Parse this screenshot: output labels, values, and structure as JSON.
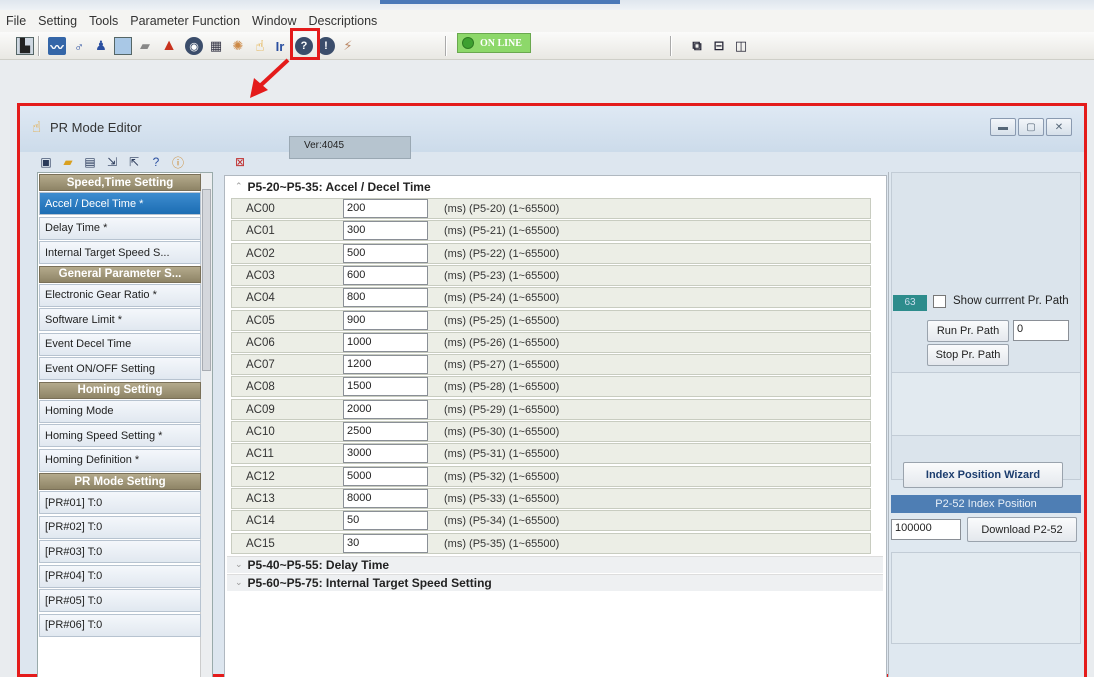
{
  "menu": [
    "File",
    "Setting",
    "Tools",
    "Parameter Function",
    "Window",
    "Descriptions"
  ],
  "toolbar": {
    "online_label": "ON LINE"
  },
  "editor": {
    "title": "PR Mode Editor",
    "version": "Ver:4045",
    "window_buttons": [
      "minimize",
      "maximize",
      "close"
    ]
  },
  "nav": {
    "items": [
      {
        "type": "head",
        "label": "Speed,Time Setting"
      },
      {
        "type": "item",
        "label": "Accel / Decel Time  *",
        "selected": true
      },
      {
        "type": "item",
        "label": "Delay Time  *"
      },
      {
        "type": "item",
        "label": "Internal Target Speed S..."
      },
      {
        "type": "head",
        "label": "General Parameter S..."
      },
      {
        "type": "item",
        "label": "Electronic Gear Ratio  *"
      },
      {
        "type": "item",
        "label": "Software Limit  *"
      },
      {
        "type": "item",
        "label": "Event Decel Time"
      },
      {
        "type": "item",
        "label": "Event ON/OFF Setting"
      },
      {
        "type": "head",
        "label": "Homing Setting"
      },
      {
        "type": "item",
        "label": "Homing Mode"
      },
      {
        "type": "item",
        "label": "Homing Speed Setting  *"
      },
      {
        "type": "item",
        "label": "Homing Definition  *"
      },
      {
        "type": "head",
        "label": "PR Mode Setting"
      },
      {
        "type": "item",
        "label": "[PR#01]  T:0"
      },
      {
        "type": "item",
        "label": "[PR#02]  T:0"
      },
      {
        "type": "item",
        "label": "[PR#03]  T:0"
      },
      {
        "type": "item",
        "label": "[PR#04]  T:0"
      },
      {
        "type": "item",
        "label": "[PR#05]  T:0"
      },
      {
        "type": "item",
        "label": "[PR#06]  T:0"
      }
    ]
  },
  "table": {
    "section_open": "P5-20~P5-35: Accel / Decel Time",
    "rows": [
      {
        "label": "AC00",
        "value": "200",
        "desc": "(ms)  (P5-20)  (1~65500)"
      },
      {
        "label": "AC01",
        "value": "300",
        "desc": "(ms)  (P5-21)  (1~65500)"
      },
      {
        "label": "AC02",
        "value": "500",
        "desc": "(ms)  (P5-22)  (1~65500)"
      },
      {
        "label": "AC03",
        "value": "600",
        "desc": "(ms)  (P5-23)  (1~65500)"
      },
      {
        "label": "AC04",
        "value": "800",
        "desc": "(ms)  (P5-24)  (1~65500)"
      },
      {
        "label": "AC05",
        "value": "900",
        "desc": "(ms)  (P5-25)  (1~65500)"
      },
      {
        "label": "AC06",
        "value": "1000",
        "desc": "(ms)  (P5-26)  (1~65500)"
      },
      {
        "label": "AC07",
        "value": "1200",
        "desc": "(ms)  (P5-27)  (1~65500)"
      },
      {
        "label": "AC08",
        "value": "1500",
        "desc": "(ms)  (P5-28)  (1~65500)"
      },
      {
        "label": "AC09",
        "value": "2000",
        "desc": "(ms)  (P5-29)  (1~65500)"
      },
      {
        "label": "AC10",
        "value": "2500",
        "desc": "(ms)  (P5-30)  (1~65500)"
      },
      {
        "label": "AC11",
        "value": "3000",
        "desc": "(ms)  (P5-31)  (1~65500)"
      },
      {
        "label": "AC12",
        "value": "5000",
        "desc": "(ms)  (P5-32)  (1~65500)"
      },
      {
        "label": "AC13",
        "value": "8000",
        "desc": "(ms)  (P5-33)  (1~65500)"
      },
      {
        "label": "AC14",
        "value": "50",
        "desc": "(ms)  (P5-34)  (1~65500)"
      },
      {
        "label": "AC15",
        "value": "30",
        "desc": "(ms)  (P5-35)  (1~65500)"
      }
    ],
    "section_delay": "P5-40~P5-55: Delay Time",
    "section_speed": "P5-60~P5-75: Internal Target Speed Setting"
  },
  "right": {
    "path_badge": "63",
    "show_path_label": "Show currrent Pr. Path",
    "run_label": "Run Pr. Path",
    "run_value": "0",
    "stop_label": "Stop Pr. Path",
    "wizard_label": "Index Position Wizard",
    "index_header": "P2-52 Index Position",
    "index_value": "100000",
    "download_label": "Download P2-52"
  },
  "colors": {
    "highlight": "#e41b1b",
    "nav_selected": "#1c6db3",
    "nav_header": "#9c9274",
    "online": "#8dd86a"
  }
}
